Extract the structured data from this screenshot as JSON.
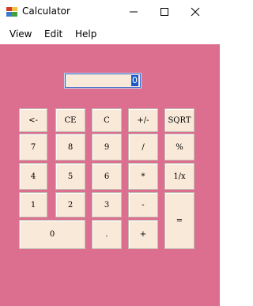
{
  "window": {
    "title": "Calculator"
  },
  "menu": {
    "items": [
      "View",
      "Edit",
      "Help"
    ]
  },
  "display": {
    "value": "0"
  },
  "keys": {
    "backspace": "<-",
    "ce": "CE",
    "c": "C",
    "negate": "+/-",
    "sqrt": "SQRT",
    "seven": "7",
    "eight": "8",
    "nine": "9",
    "divide": "/",
    "percent": "%",
    "four": "4",
    "five": "5",
    "six": "6",
    "multiply": "*",
    "reciprocal": "1/x",
    "one": "1",
    "two": "2",
    "three": "3",
    "subtract": "-",
    "equals": "=",
    "zero": "0",
    "decimal": ".",
    "add": "+"
  },
  "colors": {
    "client_background": "#dc6e8f",
    "button_face": "#f9e9d9",
    "display_selection": "#1b5bc9"
  }
}
